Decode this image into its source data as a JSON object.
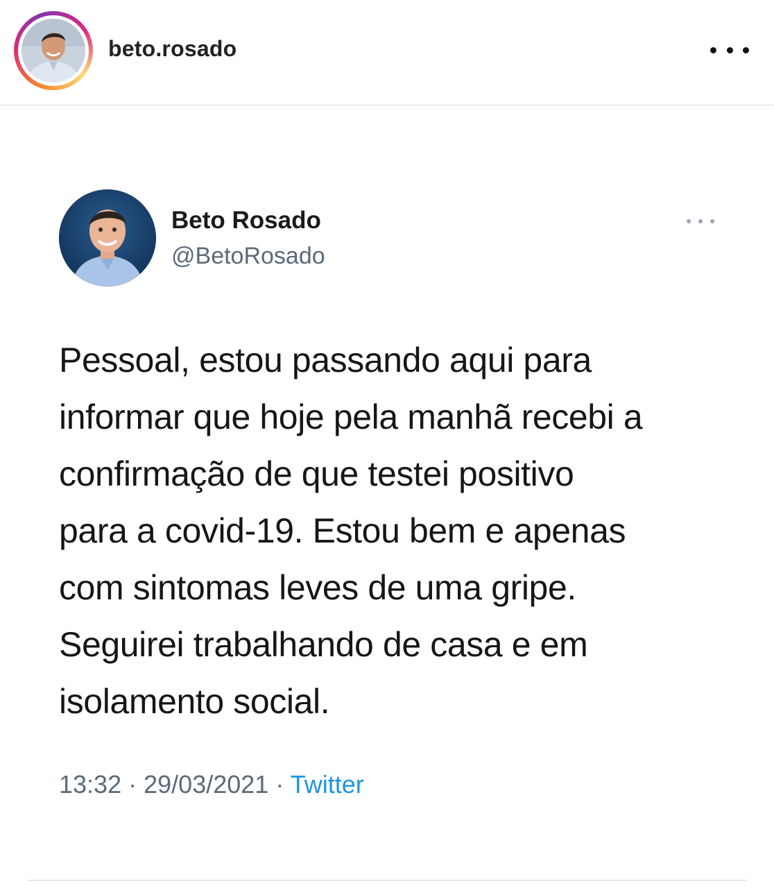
{
  "instagram_post": {
    "username": "beto.rosado",
    "more_icon": "more-horizontal-icon",
    "ring_colors": [
      "#f58529",
      "#dd2a7b",
      "#8134af",
      "#feda77"
    ]
  },
  "tweet": {
    "display_name": "Beto Rosado",
    "handle": "@BetoRosado",
    "more_icon": "more-horizontal-icon",
    "text": "Pessoal, estou passando aqui para\ninformar que hoje pela manhã recebi a\nconfirmação de que testei positivo\npara a covid-19. Estou bem e apenas\ncom sintomas leves de uma gripe.\nSeguirei trabalhando de casa e em\nisolamento social.",
    "time": "13:32",
    "separator": "·",
    "date": "29/03/2021",
    "source": "Twitter",
    "source_color": "#1b95e0"
  }
}
